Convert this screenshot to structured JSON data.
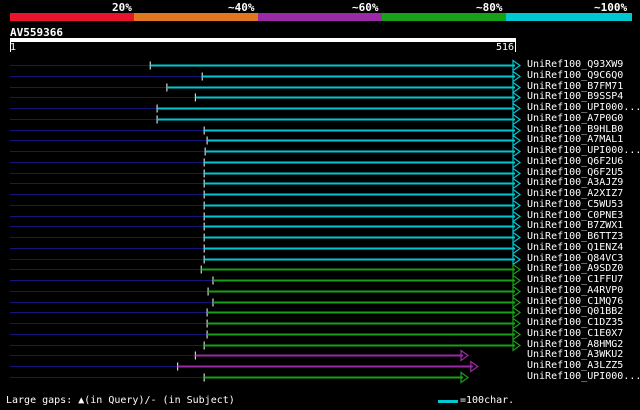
{
  "legend": {
    "labels": [
      "20%",
      "~40%",
      "~60%",
      "~80%",
      "~100%"
    ],
    "bands": [
      {
        "name": "0-20",
        "color": "#e8152a"
      },
      {
        "name": "20-40",
        "color": "#e2771d"
      },
      {
        "name": "40-60",
        "color": "#9b2aa6"
      },
      {
        "name": "60-80",
        "color": "#18a018"
      },
      {
        "name": "80-100",
        "color": "#00c8d2"
      }
    ]
  },
  "query": {
    "name": "AV559366",
    "start": "1",
    "end": "516",
    "length": 516
  },
  "hits": [
    {
      "label": "UniRef100_Q93XW9",
      "start": 143,
      "end": 516,
      "color": "cyan"
    },
    {
      "label": "UniRef100_Q9C6Q0",
      "start": 196,
      "end": 516,
      "color": "cyan"
    },
    {
      "label": "UniRef100_B7FM71",
      "start": 160,
      "end": 516,
      "color": "cyan"
    },
    {
      "label": "UniRef100_B9SSP4",
      "start": 189,
      "end": 516,
      "color": "cyan"
    },
    {
      "label": "UniRef100_UPI000...",
      "start": 150,
      "end": 516,
      "color": "cyan"
    },
    {
      "label": "UniRef100_A7P0G0",
      "start": 150,
      "end": 516,
      "color": "cyan"
    },
    {
      "label": "UniRef100_B9HLB0",
      "start": 198,
      "end": 516,
      "color": "cyan"
    },
    {
      "label": "UniRef100_A7MAL1",
      "start": 201,
      "end": 516,
      "color": "cyan"
    },
    {
      "label": "UniRef100_UPI000...",
      "start": 199,
      "end": 516,
      "color": "cyan"
    },
    {
      "label": "UniRef100_Q6F2U6",
      "start": 198,
      "end": 516,
      "color": "cyan"
    },
    {
      "label": "UniRef100_Q6F2U5",
      "start": 198,
      "end": 516,
      "color": "cyan"
    },
    {
      "label": "UniRef100_A3AJZ9",
      "start": 198,
      "end": 516,
      "color": "cyan"
    },
    {
      "label": "UniRef100_A2XIZ7",
      "start": 198,
      "end": 516,
      "color": "cyan"
    },
    {
      "label": "UniRef100_C5WU53",
      "start": 198,
      "end": 516,
      "color": "cyan"
    },
    {
      "label": "UniRef100_C0PNE3",
      "start": 198,
      "end": 516,
      "color": "cyan"
    },
    {
      "label": "UniRef100_B7ZWX1",
      "start": 198,
      "end": 516,
      "color": "cyan"
    },
    {
      "label": "UniRef100_B6TTZ3",
      "start": 198,
      "end": 516,
      "color": "cyan"
    },
    {
      "label": "UniRef100_Q1ENZ4",
      "start": 198,
      "end": 516,
      "color": "cyan"
    },
    {
      "label": "UniRef100_Q84VC3",
      "start": 198,
      "end": 516,
      "color": "cyan"
    },
    {
      "label": "UniRef100_A9SDZ0",
      "start": 195,
      "end": 516,
      "color": "green"
    },
    {
      "label": "UniRef100_C1FFU7",
      "start": 207,
      "end": 516,
      "color": "green"
    },
    {
      "label": "UniRef100_A4RVP0",
      "start": 202,
      "end": 516,
      "color": "green"
    },
    {
      "label": "UniRef100_C1MQ76",
      "start": 207,
      "end": 516,
      "color": "green"
    },
    {
      "label": "UniRef100_Q01BB2",
      "start": 201,
      "end": 516,
      "color": "green"
    },
    {
      "label": "UniRef100_C1DZ35",
      "start": 201,
      "end": 516,
      "color": "green"
    },
    {
      "label": "UniRef100_C1E0X7",
      "start": 201,
      "end": 516,
      "color": "green"
    },
    {
      "label": "UniRef100_A8HMG2",
      "start": 198,
      "end": 516,
      "color": "green"
    },
    {
      "label": "UniRef100_A3WKU2",
      "start": 189,
      "end": 463,
      "color": "purple"
    },
    {
      "label": "UniRef100_A3LZZ5",
      "start": 171,
      "end": 473,
      "color": "purple"
    },
    {
      "label": "UniRef100_UPI000...",
      "start": 198,
      "end": 463,
      "color": "green"
    }
  ],
  "footer": {
    "gaps_text": "Large gaps: ▲(in Query)/- (in Subject)",
    "scale_text": "=100char."
  }
}
